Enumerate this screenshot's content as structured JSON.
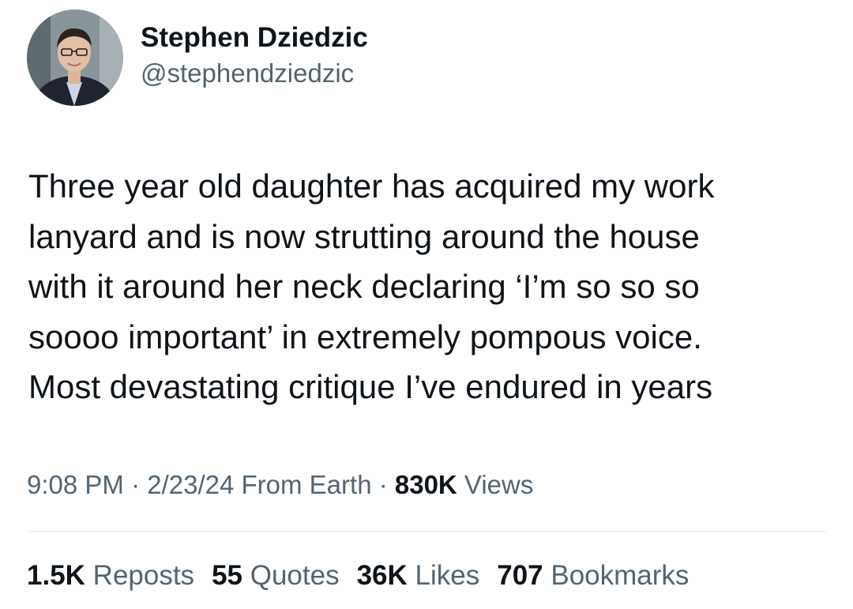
{
  "author": {
    "display_name": "Stephen Dziedzic",
    "handle": "@stephendziedzic"
  },
  "tweet": {
    "text": "Three year old daughter has acquired my work\nlanyard and is now strutting around the house\nwith it around her neck declaring ‘I’m so so so\nsoooo important’ in extremely pompous voice.\nMost devastating critique I’ve endured in years"
  },
  "meta": {
    "time": "9:08 PM",
    "sep1": " · ",
    "date": "2/23/24",
    "source": " From Earth",
    "sep2": " · ",
    "views_count": "830K",
    "views_label": " Views"
  },
  "stats": [
    {
      "count": "1.5K",
      "label": " Reposts"
    },
    {
      "count": "55",
      "label": " Quotes"
    },
    {
      "count": "36K",
      "label": " Likes"
    },
    {
      "count": "707",
      "label": " Bookmarks"
    }
  ],
  "colors": {
    "text_primary": "#0f1419",
    "text_secondary": "#536471",
    "divider": "#e6e9eb"
  }
}
